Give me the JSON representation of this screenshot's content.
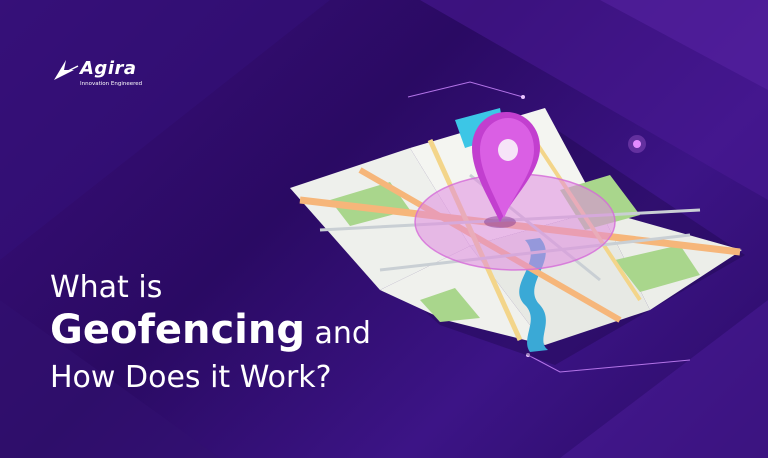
{
  "brand": {
    "name": "Agira",
    "tagline": "Innovation Engineered"
  },
  "headline": {
    "line1": "What is",
    "line2_bold": "Geofencing",
    "line2_rest": " and",
    "line3": "How Does it Work?"
  },
  "colors": {
    "background": "#2a0a63",
    "accent_pink": "#d23fd8",
    "geofence_circle": "#e08be0"
  }
}
